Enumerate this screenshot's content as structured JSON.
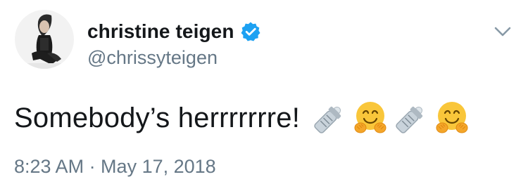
{
  "tweet": {
    "author": {
      "display_name": "christine teigen",
      "handle": "@chrissyteigen",
      "verified": true,
      "avatar": "profile-photo"
    },
    "text": "Somebody’s herrrrrrre!",
    "emoji": [
      "baby-bottle",
      "hugging-face",
      "baby-bottle",
      "hugging-face"
    ],
    "timestamp": "8:23 AM · May 17, 2018",
    "menu_icon": "chevron-down-icon"
  },
  "colors": {
    "text": "#14171a",
    "secondary_text": "#657786",
    "verified_blue": "#1da1f2",
    "emoji_yellow": "#f9c63a"
  }
}
